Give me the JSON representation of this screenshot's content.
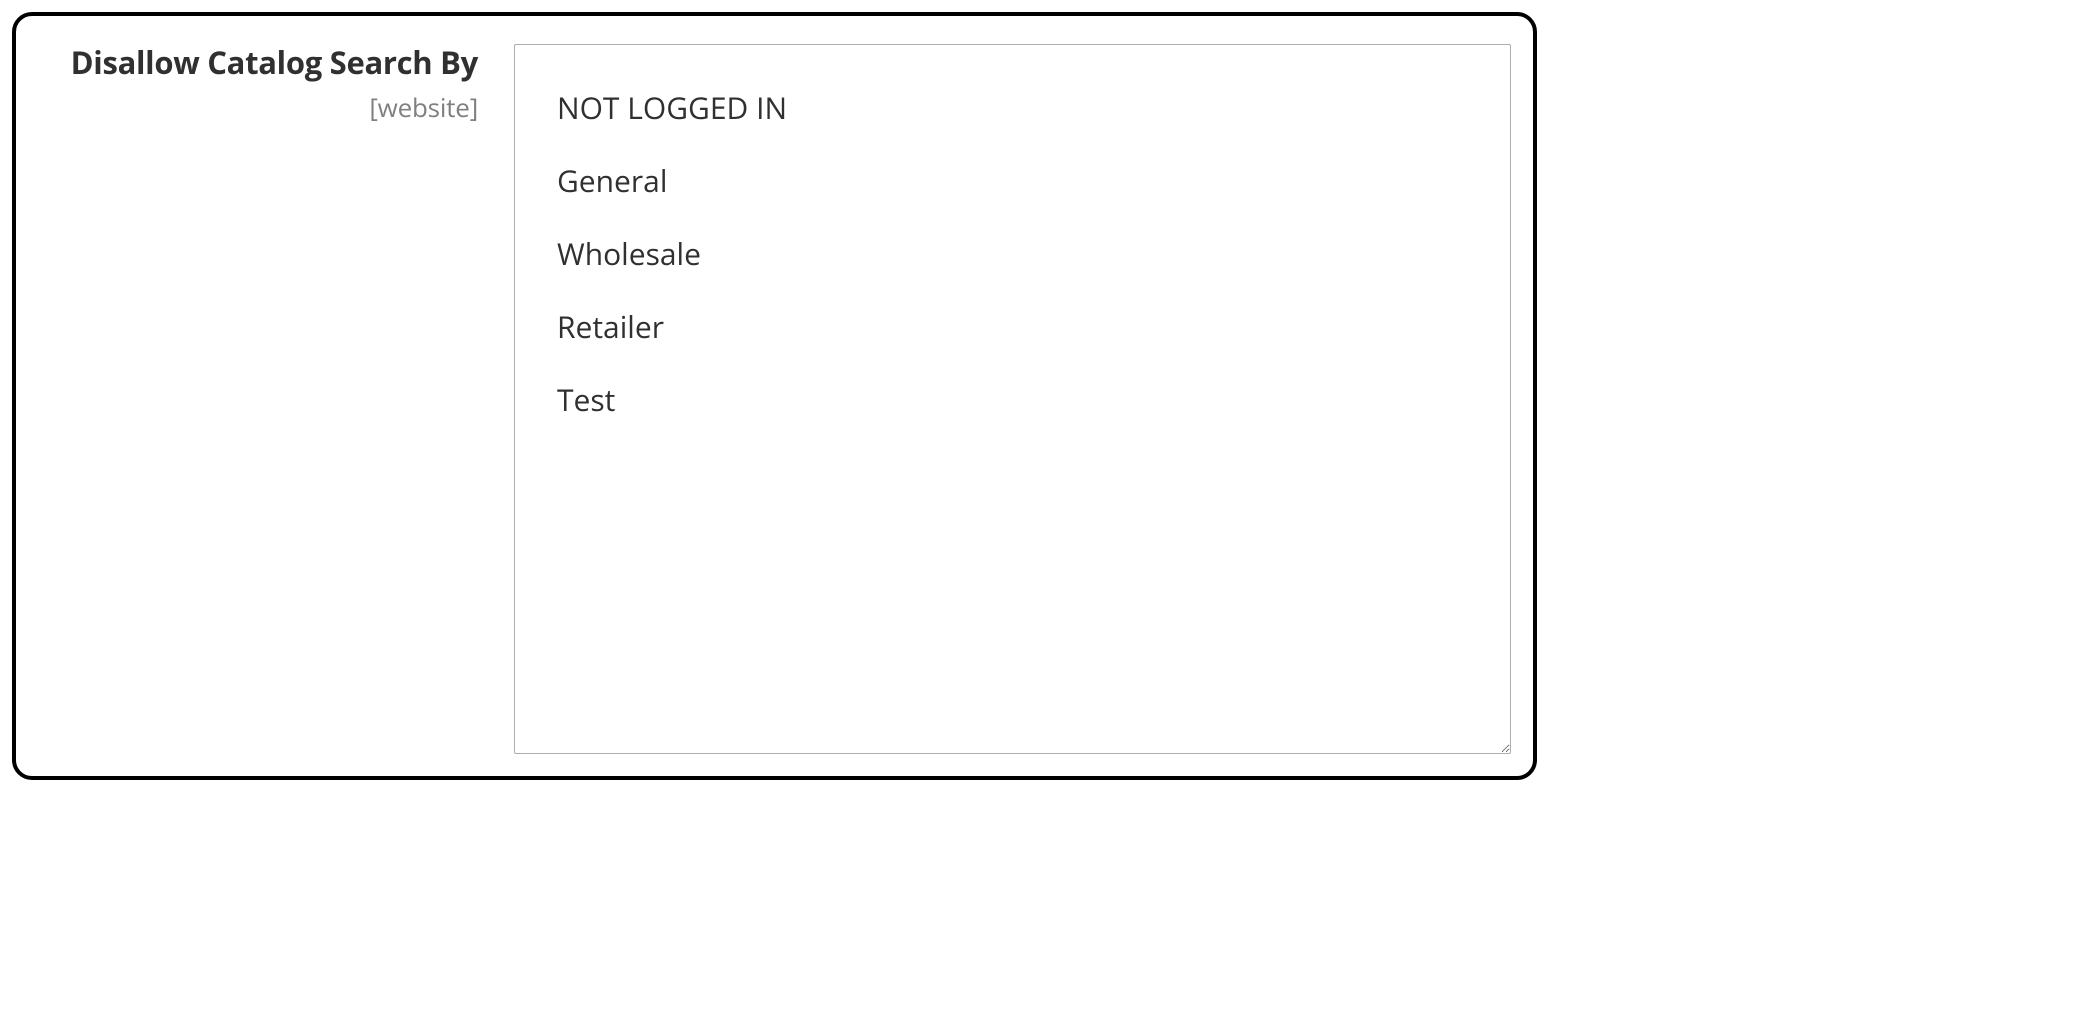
{
  "field": {
    "label": "Disallow Catalog Search By",
    "scope": "[website]",
    "options": [
      "NOT LOGGED IN",
      "General",
      "Wholesale",
      "Retailer",
      "Test"
    ]
  }
}
